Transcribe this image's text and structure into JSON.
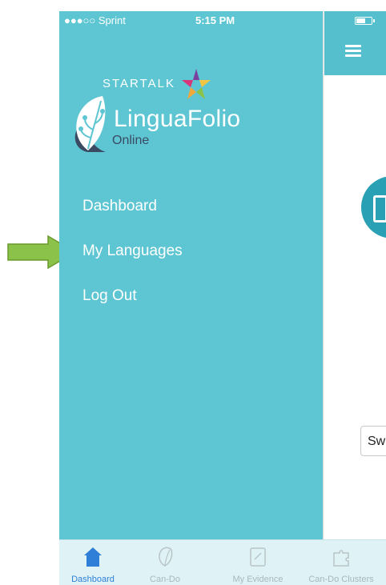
{
  "status_bar": {
    "carrier": "●●●○○ Sprint",
    "time": "5:15 PM"
  },
  "logo": {
    "startalk": "STARTALK",
    "name": "LinguaFolio",
    "online": "Online"
  },
  "menu": {
    "items": [
      {
        "label": "Dashboard"
      },
      {
        "label": "My Languages"
      },
      {
        "label": "Log Out"
      }
    ]
  },
  "content": {
    "switch_button_text": "Sw"
  },
  "tabbar": {
    "tabs": [
      {
        "label": "Dashboard",
        "icon": "house-icon",
        "active": true
      },
      {
        "label": "Can-Do",
        "icon": "leaf-icon",
        "active": false
      },
      {
        "label": "My Evidence",
        "icon": "document-icon",
        "active": false
      },
      {
        "label": "Can-Do Clusters",
        "icon": "puzzle-icon",
        "active": false
      }
    ]
  },
  "colors": {
    "drawer": "#5ec6d3",
    "header": "#55bfcd",
    "active_tab": "#2f7fd8",
    "arrow": "#8bc34a"
  }
}
